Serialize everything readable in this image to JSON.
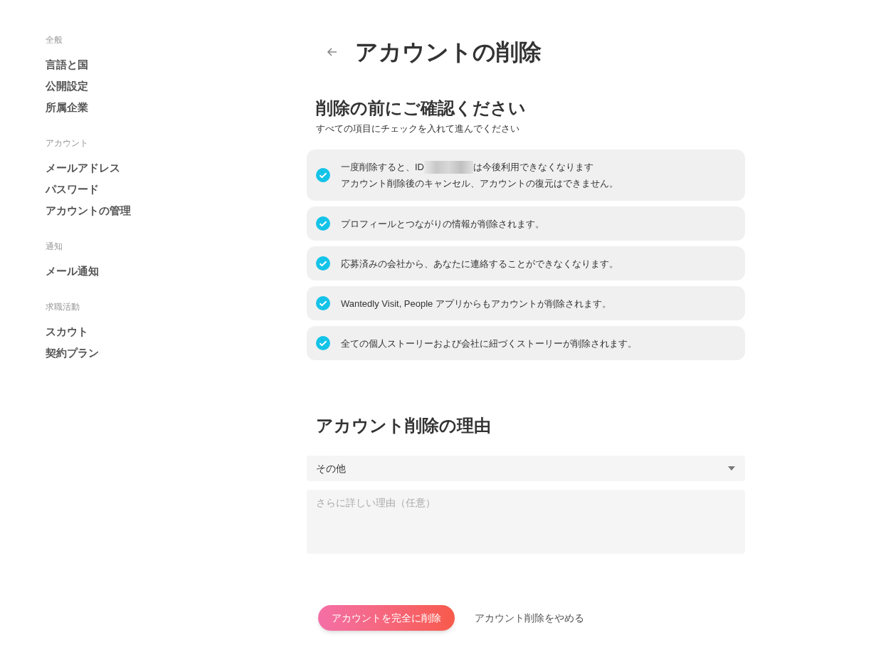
{
  "sidebar": {
    "sections": [
      {
        "heading": "全般",
        "items": [
          "言語と国",
          "公開設定",
          "所属企業"
        ]
      },
      {
        "heading": "アカウント",
        "items": [
          "メールアドレス",
          "パスワード",
          "アカウントの管理"
        ]
      },
      {
        "heading": "通知",
        "items": [
          "メール通知"
        ]
      },
      {
        "heading": "求職活動",
        "items": [
          "スカウト",
          "契約プラン"
        ]
      }
    ]
  },
  "page_title": "アカウントの削除",
  "confirm": {
    "heading": "削除の前にご確認ください",
    "subtitle": "すべての項目にチェックを入れて進んでください",
    "items": [
      {
        "kind": "redacted",
        "checked": true,
        "text_before": "一度削除すると、ID",
        "text_after": "は今後利用できなくなります",
        "second_line": "アカウント削除後のキャンセル、アカウントの復元はできません。"
      },
      {
        "kind": "plain",
        "checked": true,
        "text": "プロフィールとつながりの情報が削除されます。"
      },
      {
        "kind": "plain",
        "checked": true,
        "text": "応募済みの会社から、あなたに連絡することができなくなります。"
      },
      {
        "kind": "plain",
        "checked": true,
        "text": "Wantedly Visit, People アプリからもアカウントが削除されます。"
      },
      {
        "kind": "plain",
        "checked": true,
        "text": "全ての個人ストーリーおよび会社に紐づくストーリーが削除されます。"
      }
    ]
  },
  "reason": {
    "heading": "アカウント削除の理由",
    "select_value": "その他",
    "details_placeholder": "さらに詳しい理由（任意）"
  },
  "buttons": {
    "delete": "アカウントを完全に削除",
    "cancel": "アカウント削除をやめる"
  }
}
